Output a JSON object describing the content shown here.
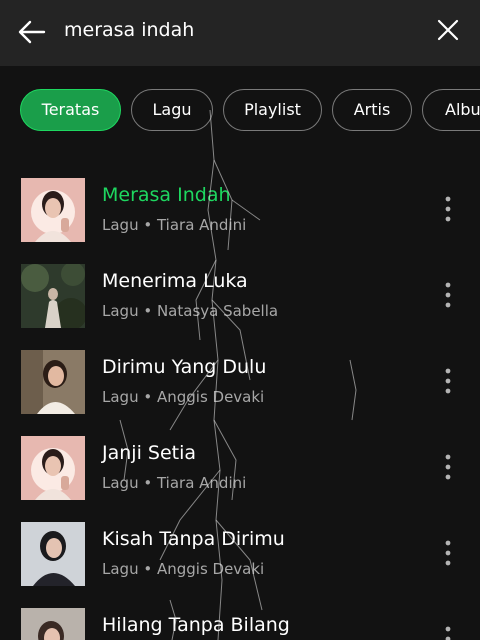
{
  "search": {
    "query": "merasa indah",
    "back_icon": "arrow-left-icon",
    "clear_icon": "close-icon"
  },
  "filters": [
    {
      "label": "Teratas",
      "active": true
    },
    {
      "label": "Lagu",
      "active": false
    },
    {
      "label": "Playlist",
      "active": false
    },
    {
      "label": "Artis",
      "active": false
    },
    {
      "label": "Album",
      "active": false
    }
  ],
  "results": [
    {
      "title": "Merasa Indah",
      "subtitle": "Lagu • Tiara Andini",
      "playing": true
    },
    {
      "title": "Menerima Luka",
      "subtitle": "Lagu • Natasya Sabella",
      "playing": false
    },
    {
      "title": "Dirimu Yang Dulu",
      "subtitle": "Lagu • Anggis Devaki",
      "playing": false
    },
    {
      "title": "Janji Setia",
      "subtitle": "Lagu • Tiara Andini",
      "playing": false
    },
    {
      "title": "Kisah Tanpa Dirimu",
      "subtitle": "Lagu • Anggis Devaki",
      "playing": false
    },
    {
      "title": "Hilang Tanpa Bilang",
      "subtitle": "",
      "playing": false
    }
  ],
  "colors": {
    "accent": "#1ed760",
    "chip_active": "#1a9e4a",
    "background": "#121212",
    "header": "#242424",
    "subtext": "#a7a7a7"
  }
}
